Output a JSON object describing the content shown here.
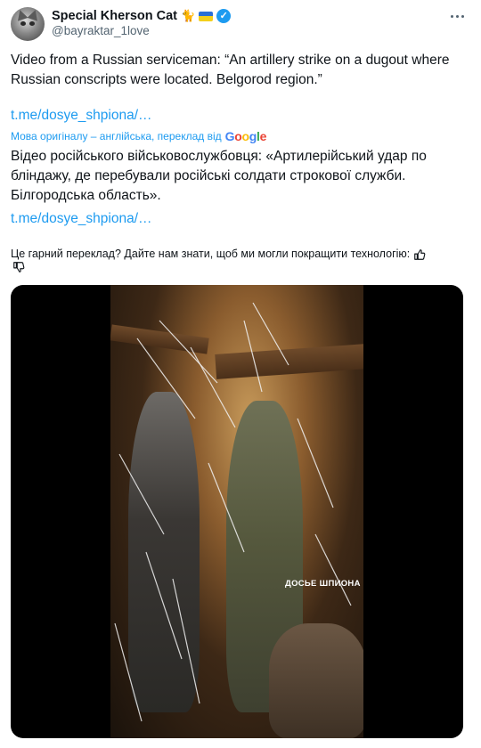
{
  "author": {
    "display_name": "Special Kherson Cat",
    "handle": "@bayraktar_1love",
    "name_emoji": "🐈",
    "flag_colors": [
      "#2a6fd6",
      "#f4cf1b"
    ]
  },
  "tweet": {
    "text": "Video from a Russian serviceman: “An artillery strike on a dugout where Russian conscripts were located. Belgorod region.”",
    "link": "t.me/dosye_shpiona/…"
  },
  "translation": {
    "note": "Мова оригіналу – англійська, переклад від",
    "provider": "Google",
    "text": "Відео російського військовослужбовця: «Артилерійський удар по бліндажу, де перебували російські солдати строкової служби. Білгородська область».",
    "link": "t.me/dosye_shpiona/…"
  },
  "feedback": {
    "question": "Це гарний переклад? Дайте нам знати, щоб ми могли покращити технологію:"
  },
  "media": {
    "watermark": "ДОСЬЕ ШПИОНА"
  },
  "colors": {
    "accent": "#1d9bf0",
    "text": "#0f1419",
    "muted": "#536471"
  },
  "icons": [
    "verified-badge-icon",
    "more-icon",
    "thumbs-up-icon",
    "thumbs-down-icon",
    "google-logo"
  ]
}
